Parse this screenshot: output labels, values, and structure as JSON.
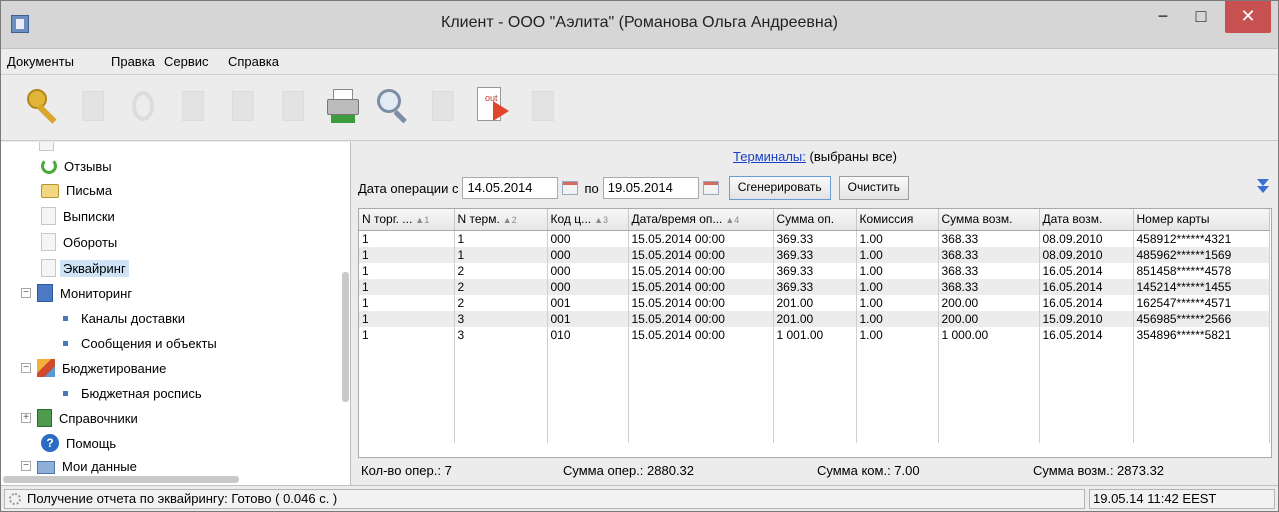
{
  "window": {
    "title": "Клиент - ООО \"Аэлита\" (Романова Ольга Андреевна)",
    "minimize_glyph": "−",
    "maximize_glyph": "□",
    "close_glyph": "✕"
  },
  "menu": [
    "Документы",
    "Правка",
    "Сервис",
    "Справка"
  ],
  "toolbar": {
    "out_label": "out",
    "icons": [
      "key-icon",
      "new-document-icon",
      "refresh-icon",
      "delete-icon",
      "edit-icon",
      "copy-icon",
      "print-icon",
      "search-icon",
      "import-icon",
      "export-out-icon",
      "cancel-icon"
    ]
  },
  "tree": {
    "items": [
      {
        "label": "Отзывы"
      },
      {
        "label": "Письма"
      },
      {
        "label": "Выписки"
      },
      {
        "label": "Обороты"
      },
      {
        "label": "Эквайринг",
        "selected": true
      },
      {
        "label": "Мониторинг",
        "toggle": "−"
      },
      {
        "label": "Каналы доставки"
      },
      {
        "label": "Сообщения и объекты"
      },
      {
        "label": "Бюджетирование",
        "toggle": "−"
      },
      {
        "label": "Бюджетная роспись"
      },
      {
        "label": "Справочники",
        "toggle": "+"
      },
      {
        "label": "Помощь",
        "icon_glyph": "?"
      },
      {
        "label": "Мои данные",
        "toggle": "−"
      }
    ]
  },
  "filter": {
    "terminals_link": "Терминалы:",
    "terminals_value": "(выбраны все)",
    "date_label": "Дата операции с",
    "date_from": "14.05.2014",
    "to_label": "по",
    "date_to": "19.05.2014",
    "generate_button": "Сгенерировать",
    "clear_button": "Очистить"
  },
  "table": {
    "columns": [
      {
        "label": "N торг. ...",
        "sort": "▲1"
      },
      {
        "label": "N терм.",
        "sort": "▲2"
      },
      {
        "label": "Код ц...",
        "sort": "▲3"
      },
      {
        "label": "Дата/время оп...",
        "sort": "▲4"
      },
      {
        "label": "Сумма оп.",
        "sort": ""
      },
      {
        "label": "Комиссия",
        "sort": ""
      },
      {
        "label": "Сумма возм.",
        "sort": ""
      },
      {
        "label": "Дата возм.",
        "sort": ""
      },
      {
        "label": "Номер карты",
        "sort": ""
      }
    ],
    "rows": [
      [
        "1",
        "1",
        "000",
        "15.05.2014 00:00",
        "369.33",
        "1.00",
        "368.33",
        "08.09.2010",
        "458912******4321"
      ],
      [
        "1",
        "1",
        "000",
        "15.05.2014 00:00",
        "369.33",
        "1.00",
        "368.33",
        "08.09.2010",
        "485962******1569"
      ],
      [
        "1",
        "2",
        "000",
        "15.05.2014 00:00",
        "369.33",
        "1.00",
        "368.33",
        "16.05.2014",
        "851458******4578"
      ],
      [
        "1",
        "2",
        "000",
        "15.05.2014 00:00",
        "369.33",
        "1.00",
        "368.33",
        "16.05.2014",
        "145214******1455"
      ],
      [
        "1",
        "2",
        "001",
        "15.05.2014 00:00",
        "201.00",
        "1.00",
        "200.00",
        "16.05.2014",
        "162547******4571"
      ],
      [
        "1",
        "3",
        "001",
        "15.05.2014 00:00",
        "201.00",
        "1.00",
        "200.00",
        "15.09.2010",
        "456985******2566"
      ],
      [
        "1",
        "3",
        "010",
        "15.05.2014 00:00",
        "1 001.00",
        "1.00",
        "1 000.00",
        "16.05.2014",
        "354896******5821"
      ]
    ]
  },
  "summary": {
    "count": "Кол-во опер.: 7",
    "sum_ops": "Сумма опер.: 2880.32",
    "sum_commission": "Сумма ком.: 7.00",
    "sum_refund": "Сумма возм.: 2873.32"
  },
  "status": {
    "message": "Получение отчета по эквайрингу: Готово ( 0.046 с. )",
    "datetime": "19.05.14 11:42 EEST"
  }
}
